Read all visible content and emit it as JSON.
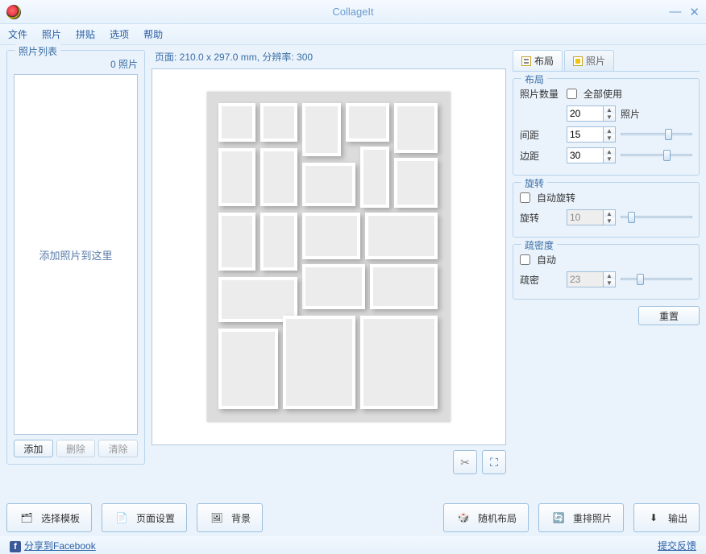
{
  "title": "CollageIt",
  "menu": {
    "file": "文件",
    "photo": "照片",
    "collage": "拼贴",
    "options": "选项",
    "help": "帮助"
  },
  "left": {
    "title": "照片列表",
    "count_label": "0 照片",
    "placeholder": "添加照片到这里",
    "add": "添加",
    "delete": "删除",
    "clear": "清除"
  },
  "center": {
    "page_info": "页面: 210.0 x 297.0 mm, 分辨率: 300"
  },
  "tabs": {
    "layout": "布局",
    "photo": "照片"
  },
  "layout_group": {
    "title": "布局",
    "photo_count_label": "照片数量",
    "use_all": "全部使用",
    "count_value": "20",
    "photos_suffix": "照片",
    "spacing_label": "间距",
    "spacing_value": "15",
    "margin_label": "边距",
    "margin_value": "30"
  },
  "rotate_group": {
    "title": "旋转",
    "auto": "自动旋转",
    "rotate_label": "旋转",
    "rotate_value": "10"
  },
  "density_group": {
    "title": "疏密度",
    "auto": "自动",
    "density_label": "疏密",
    "density_value": "23"
  },
  "reset": "重置",
  "toolbar": {
    "template": "选择模板",
    "page_setup": "页面设置",
    "background": "背景",
    "random": "随机布局",
    "rearrange": "重排照片",
    "output": "输出"
  },
  "status": {
    "share": "分享到Facebook",
    "feedback": "提交反馈"
  }
}
